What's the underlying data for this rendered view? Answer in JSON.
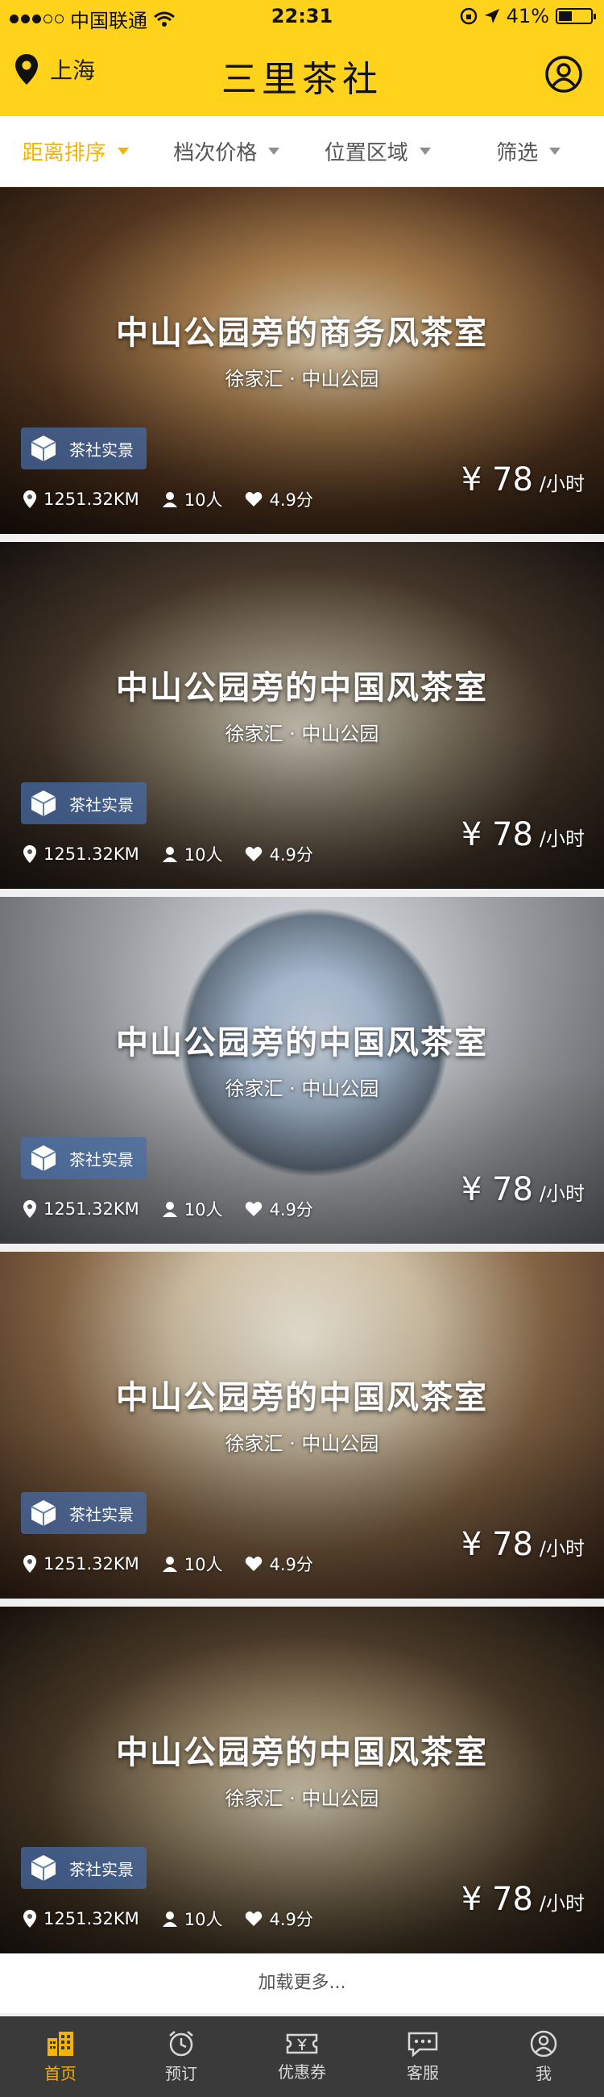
{
  "status": {
    "carrier": "中国联通",
    "time": "22:31",
    "battery": "41%",
    "battery_fraction": 0.41
  },
  "header": {
    "city": "上海",
    "title": "三里茶社"
  },
  "filters": [
    {
      "label": "距离排序",
      "active": true
    },
    {
      "label": "档次价格",
      "active": false
    },
    {
      "label": "位置区域",
      "active": false
    },
    {
      "label": "筛选",
      "active": false
    }
  ],
  "cards": [
    {
      "title": "中山公园旁的商务风茶室",
      "subtitle": "徐家汇 · 中山公园",
      "badge": "茶社实景",
      "distance": "1251.32KM",
      "people": "10人",
      "rating": "4.9分",
      "price": "¥ 78",
      "unit": "/小时"
    },
    {
      "title": "中山公园旁的中国风茶室",
      "subtitle": "徐家汇 · 中山公园",
      "badge": "茶社实景",
      "distance": "1251.32KM",
      "people": "10人",
      "rating": "4.9分",
      "price": "¥ 78",
      "unit": "/小时"
    },
    {
      "title": "中山公园旁的中国风茶室",
      "subtitle": "徐家汇 · 中山公园",
      "badge": "茶社实景",
      "distance": "1251.32KM",
      "people": "10人",
      "rating": "4.9分",
      "price": "¥ 78",
      "unit": "/小时"
    },
    {
      "title": "中山公园旁的中国风茶室",
      "subtitle": "徐家汇 · 中山公园",
      "badge": "茶社实景",
      "distance": "1251.32KM",
      "people": "10人",
      "rating": "4.9分",
      "price": "¥ 78",
      "unit": "/小时"
    },
    {
      "title": "中山公园旁的中国风茶室",
      "subtitle": "徐家汇 · 中山公园",
      "badge": "茶社实景",
      "distance": "1251.32KM",
      "people": "10人",
      "rating": "4.9分",
      "price": "¥ 78",
      "unit": "/小时"
    }
  ],
  "load_more": "加载更多...",
  "tabs": [
    {
      "label": "首页",
      "icon": "building-icon",
      "active": true
    },
    {
      "label": "预订",
      "icon": "alarm-clock-icon",
      "active": false
    },
    {
      "label": "优惠券",
      "icon": "coupon-icon",
      "active": false
    },
    {
      "label": "客服",
      "icon": "chat-icon",
      "active": false
    },
    {
      "label": "我",
      "icon": "user-icon",
      "active": false
    }
  ],
  "colors": {
    "brand": "#ffd21c",
    "accent": "#f5b400",
    "tabbar": "#3a3a3a"
  }
}
